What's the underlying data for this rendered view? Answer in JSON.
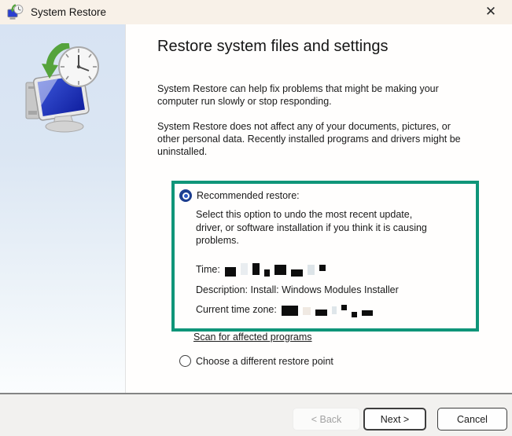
{
  "window": {
    "title": "System Restore",
    "close_glyph": "✕"
  },
  "main": {
    "heading": "Restore system files and settings",
    "para1": "System Restore can help fix problems that might be making your\ncomputer run slowly or stop responding.",
    "para2": "System Restore does not affect any of your documents, pictures, or\nother personal data. Recently installed programs and drivers might be\nuninstalled."
  },
  "recommended": {
    "highlight_color": "#0f9579",
    "radio_label": "Recommended restore:",
    "radio_selected": true,
    "description": "Select this option to undo the most recent update,\ndriver, or software installation if you think it is causing\nproblems.",
    "time_label": "Time:",
    "time_value_redacted": true,
    "time_redaction": [
      [
        14,
        12,
        3,
        "#0d0d0d"
      ],
      [
        9,
        15,
        0,
        "#e9edf0"
      ],
      [
        9,
        15,
        0,
        "#0d0d0d"
      ],
      [
        7,
        9,
        5,
        "#0d0d0d"
      ],
      [
        15,
        13,
        1,
        "#0d0d0d"
      ],
      [
        15,
        9,
        5,
        "#0d0d0d"
      ],
      [
        9,
        13,
        1,
        "#dde4e8"
      ],
      [
        8,
        8,
        -2,
        "#0d0d0d"
      ]
    ],
    "description_line": "Description: Install: Windows Modules Installer",
    "timezone_label": "Current time zone:",
    "timezone_value_redacted": true,
    "timezone_redaction": [
      [
        21,
        13,
        1,
        "#0d0d0d"
      ],
      [
        10,
        10,
        2,
        "#f0e9e2"
      ],
      [
        15,
        8,
        4,
        "#0d0d0d"
      ],
      [
        6,
        10,
        1,
        "#dfe6ea"
      ],
      [
        7,
        7,
        -3,
        "#0d0d0d"
      ],
      [
        7,
        7,
        6,
        "#0d0d0d"
      ],
      [
        14,
        7,
        4,
        "#0d0d0d"
      ]
    ]
  },
  "scan_link_label": "Scan for affected programs",
  "choose_other": {
    "radio_label": "Choose a different restore point",
    "radio_selected": false
  },
  "footer": {
    "back_label": "< Back",
    "next_label": "Next >",
    "cancel_label": "Cancel"
  }
}
